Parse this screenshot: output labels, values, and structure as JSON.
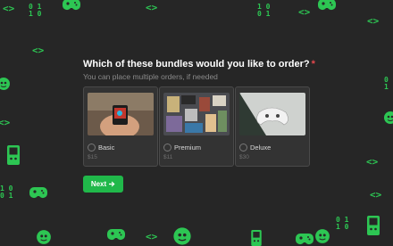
{
  "question": {
    "text": "Which of these bundles would you like to order?",
    "required_mark": "*",
    "hint": "You can place multiple orders, if needed"
  },
  "options": [
    {
      "label": "Basic",
      "price": "$15",
      "image": "hand-holding-handheld-console-photo"
    },
    {
      "label": "Premium",
      "price": "$11",
      "image": "flatlay-of-gaming-gear-photo"
    },
    {
      "label": "Deluxe",
      "price": "$30",
      "image": "white-game-controller-photo"
    }
  ],
  "next_button": {
    "label": "Next",
    "icon": "arrow-right-icon"
  },
  "theme": {
    "background": "#262626",
    "accent": "#2dc653",
    "button": "#20b84a",
    "required": "#e5484d"
  },
  "decor": {
    "code_glyph": "<>",
    "binary_a": "0 1\n1 0",
    "binary_b": "1 0\n0 1"
  }
}
